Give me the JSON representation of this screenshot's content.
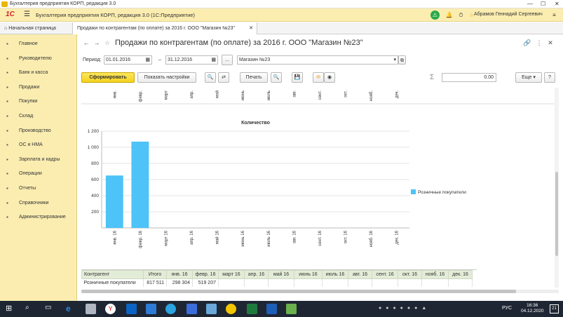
{
  "window": {
    "title": "Бухгалтерия предприятия КОРП, редакция 3.0"
  },
  "app_header": {
    "logo": "1С",
    "title": "Бухгалтерия предприятия КОРП, редакция 3.0   (1С:Предприятие)",
    "user": "Абрамов Геннадий Сергеевич"
  },
  "tabs": {
    "home": "Начальная страница",
    "report": "Продажи по контрагентам (по оплате) за 2016 г. ООО \"Магазин №23\""
  },
  "sidebar": {
    "items": [
      {
        "label": "Главное",
        "icon": "grid-icon"
      },
      {
        "label": "Руководителю",
        "icon": "chart-line-icon"
      },
      {
        "label": "Банк и касса",
        "icon": "bank-icon"
      },
      {
        "label": "Продажи",
        "icon": "cart-icon"
      },
      {
        "label": "Покупки",
        "icon": "basket-icon"
      },
      {
        "label": "Склад",
        "icon": "warehouse-icon"
      },
      {
        "label": "Производство",
        "icon": "factory-icon"
      },
      {
        "label": "ОС и НМА",
        "icon": "building-icon"
      },
      {
        "label": "Зарплата и кадры",
        "icon": "people-icon"
      },
      {
        "label": "Операции",
        "icon": "operations-icon"
      },
      {
        "label": "Отчеты",
        "icon": "report-icon"
      },
      {
        "label": "Справочники",
        "icon": "book-icon"
      },
      {
        "label": "Администрирование",
        "icon": "gear-icon"
      }
    ]
  },
  "report": {
    "title": "Продажи по контрагентам (по оплате) за 2016 г. ООО \"Магазин №23\"",
    "period_label": "Период:",
    "date_from": "01.01.2016",
    "date_sep": "–",
    "date_to": "31.12.2016",
    "ellipsis": "...",
    "organization": "Магазин №23",
    "buttons": {
      "form": "Сформировать",
      "settings": "Показать настройки",
      "print": "Печать",
      "more": "Еще ▾",
      "help": "?"
    },
    "sum_icon": "Σ",
    "sum_value": "0.00"
  },
  "chart_data": {
    "type": "bar",
    "title": "Количество",
    "categories": [
      "янв. 16",
      "февр. 16",
      "март 16",
      "апр. 16",
      "май 16",
      "июнь 16",
      "июль 16",
      "авг. 16",
      "сент. 16",
      "окт. 16",
      "нояб. 16",
      "дек. 16"
    ],
    "top_labels": [
      "янв.",
      "февр.",
      "март",
      "апр.",
      "май",
      "июнь",
      "июль",
      "авг.",
      "сент.",
      "окт.",
      "нояб.",
      "дек."
    ],
    "series": [
      {
        "name": "Розничные покупатели",
        "values": [
          650,
          1070,
          0,
          0,
          0,
          0,
          0,
          0,
          0,
          0,
          0,
          0
        ]
      }
    ],
    "ylim": [
      0,
      1200
    ],
    "yticks": [
      "1 200",
      "1 000",
      "800",
      "600",
      "400",
      "200"
    ],
    "legend": "right",
    "color": "#4dc3f7"
  },
  "table": {
    "headers": [
      "Контрагент",
      "Итого",
      "янв. 16",
      "февр. 16",
      "март 16",
      "апр. 16",
      "май 16",
      "июнь 16",
      "июль 16",
      "авг. 16",
      "сент. 16",
      "окт. 16",
      "нояб. 16",
      "дек. 16"
    ],
    "rows": [
      [
        "Розничные покупатели",
        "817 511",
        "298 304",
        "519 207",
        "",
        "",
        "",
        "",
        "",
        "",
        "",
        "",
        "",
        ""
      ]
    ]
  },
  "taskbar": {
    "lang": "РУС",
    "time": "16:36",
    "date": "04.12.2020",
    "badge": "21"
  }
}
